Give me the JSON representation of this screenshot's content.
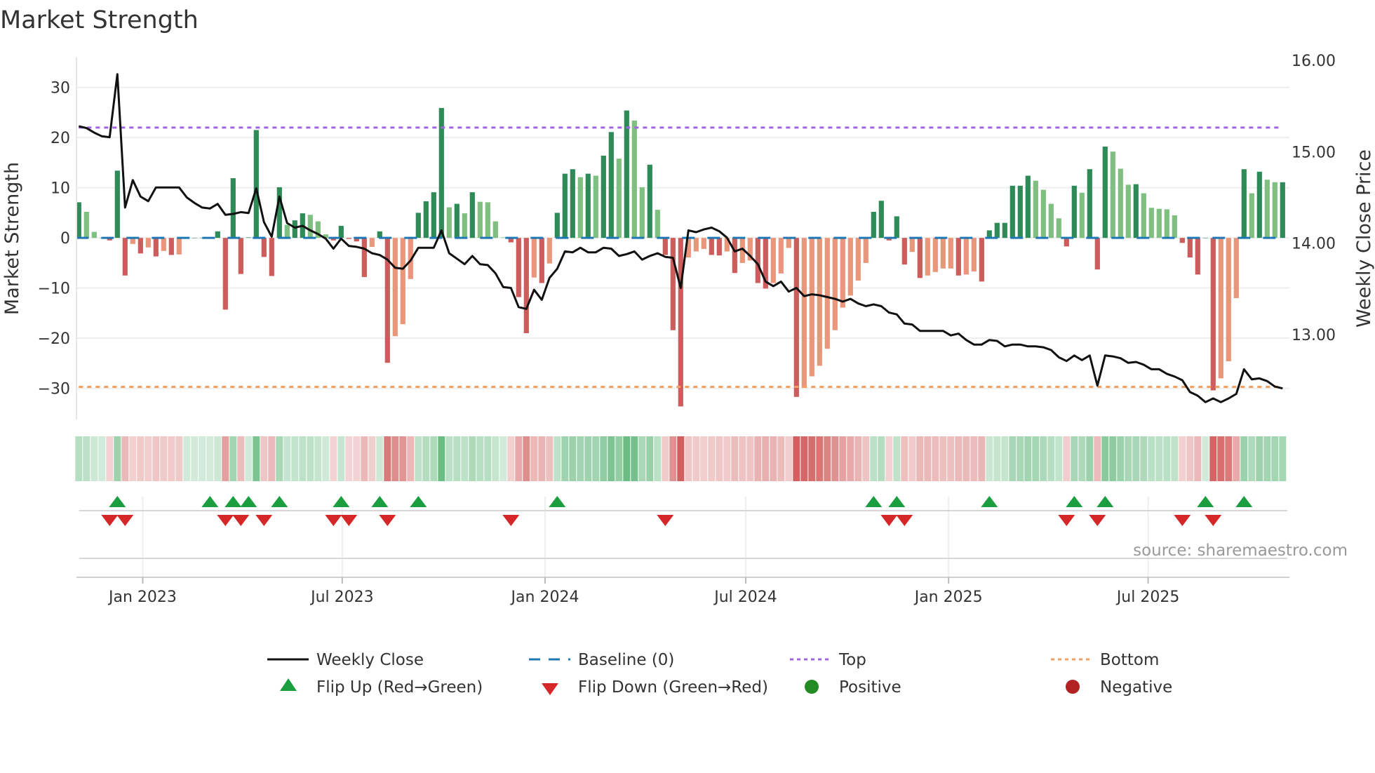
{
  "chart_data": {
    "type": "bar",
    "title": "Market Strength",
    "ylabel": "Market Strength",
    "ylabel_right": "Weekly Close Price",
    "ylim": [
      -36.2,
      36.1
    ],
    "ylim_right": [
      12.07,
      16.04
    ],
    "yticks": [
      30,
      20,
      10,
      0,
      -10,
      -20,
      -30
    ],
    "ytick_labels": [
      "30",
      "20",
      "10",
      "0",
      "−10",
      "−20",
      "−30"
    ],
    "yticks_right": [
      16,
      15,
      14,
      13
    ],
    "ytick_labels_right": [
      "16.00",
      "15.00",
      "14.00",
      "13.00"
    ],
    "x_start": "2022-11-04",
    "x_step_days": 7,
    "xticks": [
      "2023-01-01",
      "2023-07-01",
      "2024-01-01",
      "2024-07-01",
      "2025-01-01",
      "2025-07-01"
    ],
    "xtick_labels": [
      "Jan 2023",
      "Jul 2023",
      "Jan 2024",
      "Jul 2024",
      "Jan 2025",
      "Jul 2025"
    ],
    "grid": true,
    "top_level": 22,
    "bottom_level": -29.7,
    "baseline": 0,
    "strength": [
      7.1,
      5.2,
      1.2,
      0,
      -0.5,
      13.4,
      -7.5,
      -1.2,
      -3.1,
      -1.9,
      -3.7,
      -2.6,
      -3.4,
      -3.3,
      0,
      0,
      0,
      0,
      1.3,
      -14.3,
      11.9,
      -7.2,
      0.1,
      21.5,
      -3.8,
      -7.6,
      10.1,
      2.6,
      3.5,
      4.9,
      4.6,
      3.3,
      0.7,
      -0.5,
      2.4,
      -0.2,
      -0.7,
      -7.8,
      -1.8,
      1.3,
      -24.9,
      -19.6,
      -17.2,
      -8.2,
      5.0,
      7.3,
      9.1,
      25.9,
      6.1,
      6.8,
      4.9,
      9.1,
      7.2,
      7.1,
      3.3,
      0.1,
      -0.9,
      -11.8,
      -19.0,
      -7.9,
      -9.0,
      -5.1,
      5.0,
      12.8,
      13.7,
      12.1,
      12.8,
      12.4,
      16.4,
      21.1,
      15.8,
      25.4,
      23.4,
      10.1,
      14.6,
      5.6,
      -3.4,
      -18.4,
      -33.6,
      -3.9,
      -2.7,
      -2.2,
      -3.4,
      -3.5,
      -2.7,
      -7.0,
      -5.0,
      -4.5,
      -9.0,
      -10.1,
      -9.0,
      -7.1,
      -2.0,
      -31.7,
      -29.9,
      -27.6,
      -25.5,
      -22.1,
      -18.4,
      -13.9,
      -11.5,
      -8.5,
      -5.0,
      5.2,
      7.4,
      -0.5,
      4.3,
      -5.3,
      -2.8,
      -8.0,
      -7.5,
      -6.8,
      -6.1,
      -6.1,
      -7.5,
      -7.3,
      -6.7,
      -8.7,
      1.5,
      3.0,
      3.0,
      10.4,
      10.4,
      12.4,
      11.4,
      9.6,
      6.8,
      3.9,
      -1.7,
      10.4,
      9.0,
      13.7,
      -6.3,
      18.2,
      17.2,
      13.8,
      10.6,
      10.7,
      8.9,
      6.0,
      5.8,
      5.7,
      4.5,
      -1.0,
      -3.9,
      -7.3,
      0,
      -30.4,
      -28.0,
      -24.6,
      -12.0,
      13.7,
      8.9,
      13.2,
      11.6,
      11.1,
      11.1
    ],
    "weekly_close": [
      15.28,
      15.26,
      15.21,
      15.17,
      15.16,
      15.85,
      14.39,
      14.69,
      14.51,
      14.46,
      14.61,
      14.61,
      14.61,
      14.61,
      14.5,
      14.44,
      14.39,
      14.38,
      14.43,
      14.31,
      14.32,
      14.34,
      14.33,
      14.6,
      14.23,
      14.07,
      14.51,
      14.22,
      14.17,
      14.19,
      14.14,
      14.1,
      14.05,
      13.94,
      14.05,
      13.97,
      13.96,
      13.94,
      13.89,
      13.87,
      13.82,
      13.73,
      13.72,
      13.81,
      13.95,
      13.95,
      13.95,
      14.14,
      13.89,
      13.83,
      13.77,
      13.86,
      13.77,
      13.76,
      13.67,
      13.52,
      13.51,
      13.3,
      13.28,
      13.49,
      13.38,
      13.62,
      13.72,
      13.91,
      13.9,
      13.95,
      13.9,
      13.9,
      13.95,
      13.94,
      13.86,
      13.88,
      13.91,
      13.82,
      13.86,
      13.89,
      13.85,
      13.84,
      13.51,
      14.14,
      14.12,
      14.15,
      14.17,
      14.13,
      14.06,
      13.91,
      13.94,
      13.86,
      13.77,
      13.58,
      13.53,
      13.58,
      13.47,
      13.51,
      13.42,
      13.44,
      13.43,
      13.41,
      13.39,
      13.36,
      13.39,
      13.34,
      13.31,
      13.33,
      13.31,
      13.24,
      13.22,
      13.12,
      13.11,
      13.04,
      13.04,
      13.04,
      13.04,
      12.99,
      13.01,
      12.94,
      12.89,
      12.89,
      12.94,
      12.93,
      12.87,
      12.89,
      12.89,
      12.87,
      12.87,
      12.86,
      12.83,
      12.75,
      12.71,
      12.77,
      12.72,
      12.77,
      12.44,
      12.77,
      12.76,
      12.74,
      12.69,
      12.7,
      12.67,
      12.62,
      12.62,
      12.57,
      12.54,
      12.5,
      12.37,
      12.33,
      12.26,
      12.3,
      12.26,
      12.3,
      12.35,
      12.62,
      12.51,
      12.52,
      12.49,
      12.43,
      12.41
    ],
    "flip_up_weeks": [
      5,
      17,
      20,
      22,
      26,
      34,
      39,
      44,
      62,
      103,
      106,
      118,
      129,
      133,
      146,
      151
    ],
    "flip_down_weeks": [
      4,
      6,
      19,
      21,
      24,
      33,
      35,
      40,
      56,
      76,
      105,
      107,
      128,
      132,
      143,
      147
    ],
    "legend": {
      "placement": "bottom",
      "weekly_close": "Weekly Close",
      "baseline": "Baseline (0)",
      "top": "Top",
      "bottom": "Bottom",
      "flip_up": "Flip Up (Red→Green)",
      "flip_down": "Flip Down (Green→Red)",
      "positive": "Positive",
      "negative": "Negative"
    },
    "source": "source: sharemaestro.com"
  },
  "colors": {
    "up_strong": "#2e8b57",
    "up_weak": "#7fbf7f",
    "down_strong": "#cd5c5c",
    "down_weak": "#e9967a",
    "baseline": "#1f77b4",
    "top": "#a066e0",
    "bottom": "#f0a060",
    "line": "#111111",
    "flip_up": "#1a9e3f",
    "flip_down": "#d62728",
    "positive": "#228b22",
    "negative": "#b22222"
  }
}
